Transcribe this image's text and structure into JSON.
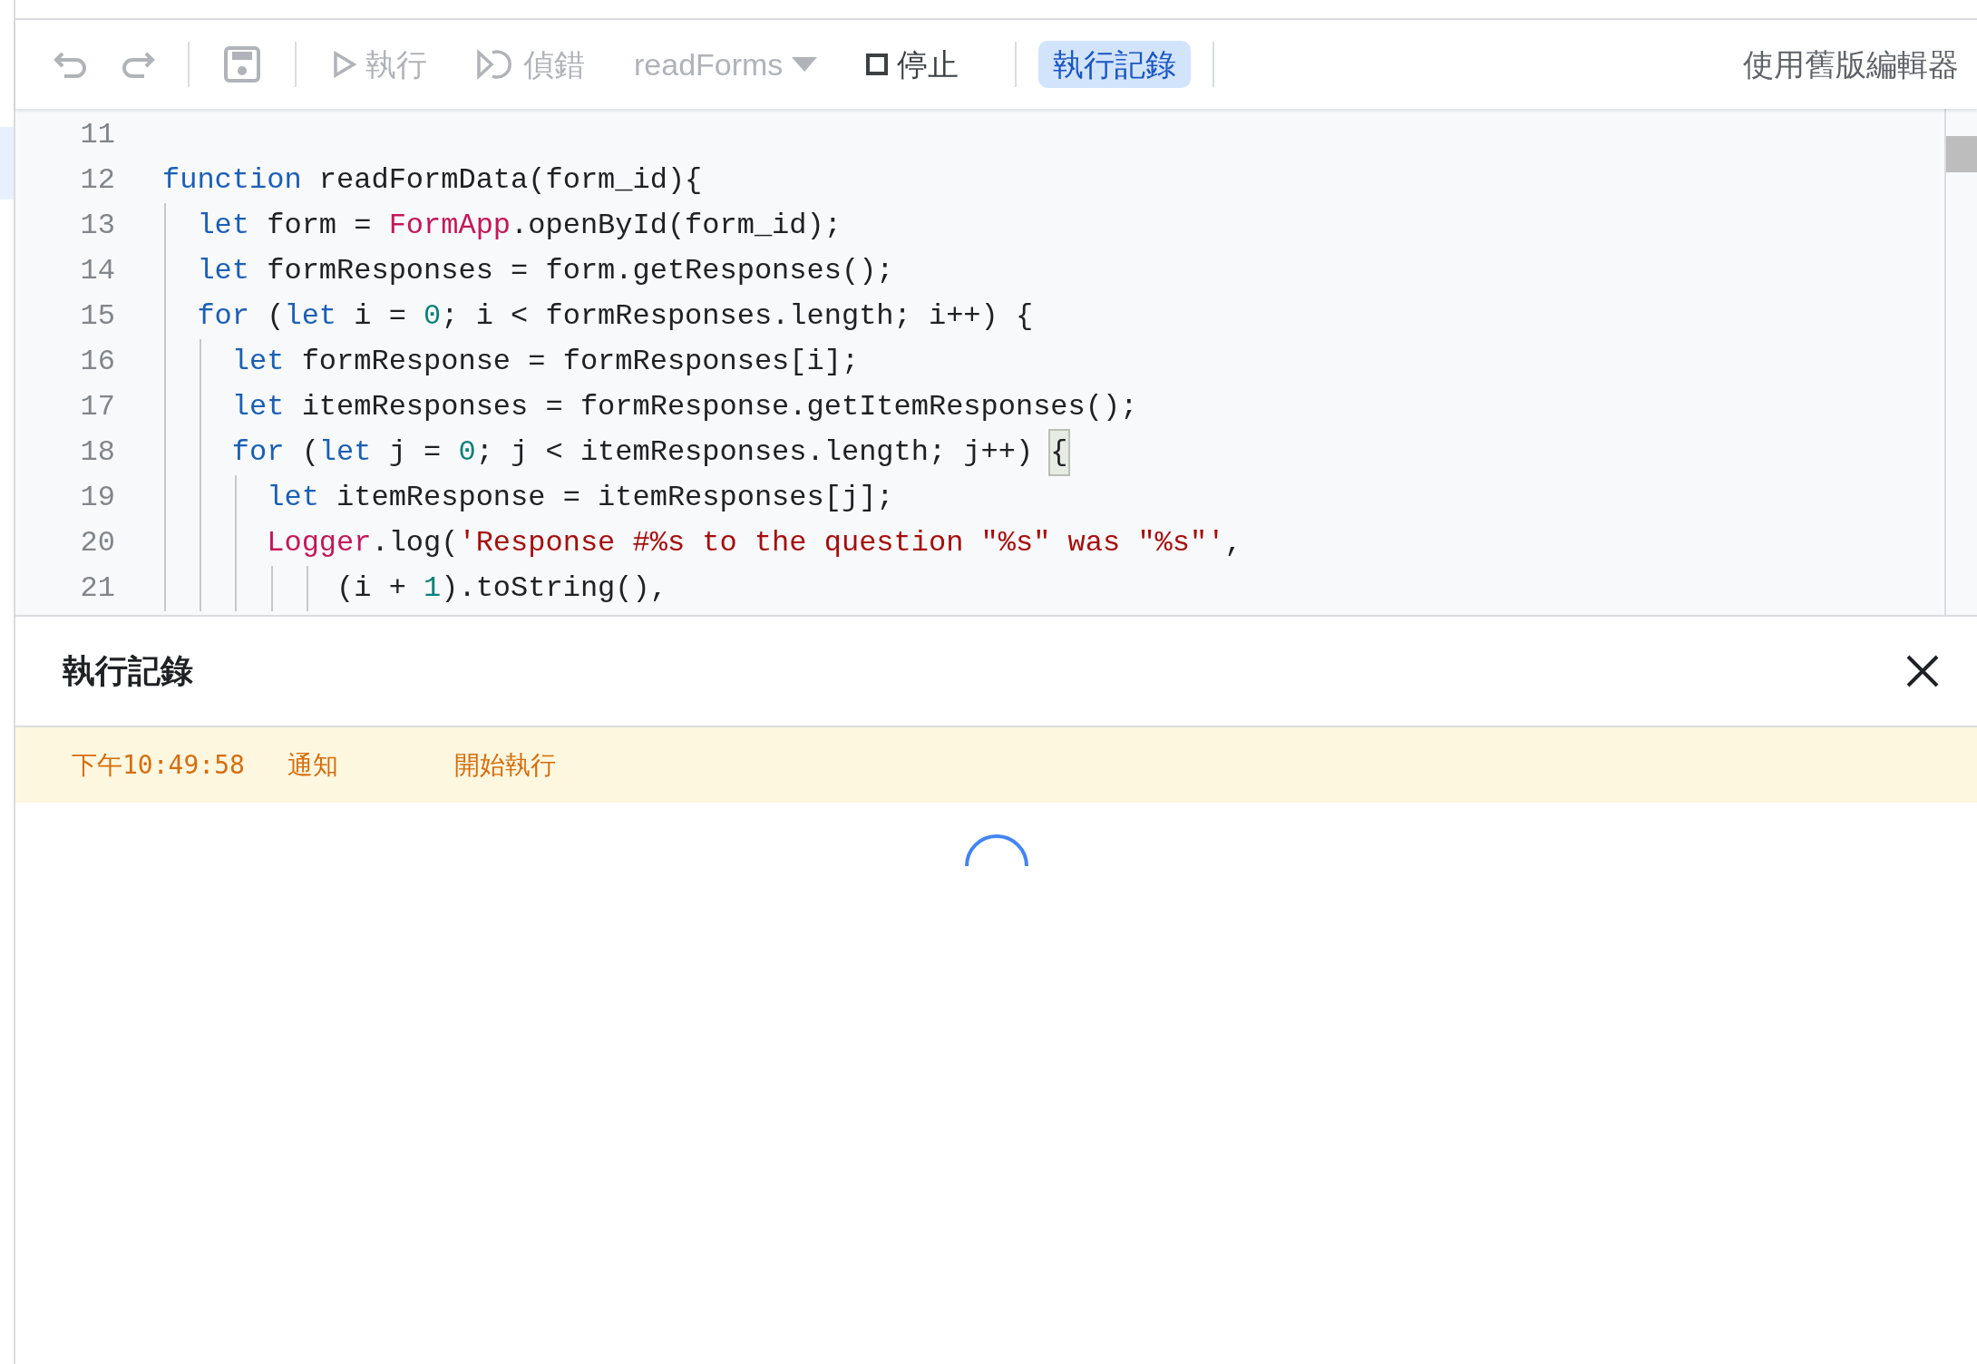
{
  "toolbar": {
    "items": [
      {
        "kind": "undo",
        "disabled": true
      },
      {
        "kind": "redo",
        "disabled": true
      },
      {
        "kind": "separator"
      },
      {
        "kind": "save",
        "disabled": true
      },
      {
        "kind": "separator"
      },
      {
        "kind": "run",
        "label": "執行",
        "disabled": true
      },
      {
        "kind": "debug",
        "label": "偵錯",
        "disabled": true
      },
      {
        "kind": "dropdown",
        "label": "readForms",
        "disabled": true
      },
      {
        "kind": "stop",
        "label": "停止",
        "disabled": false
      },
      {
        "kind": "separator"
      },
      {
        "kind": "toggle",
        "label": "執行記錄",
        "selected": true
      },
      {
        "kind": "separator"
      }
    ],
    "legacy_button": "使用舊版編輯器"
  },
  "editor": {
    "lines": [
      {
        "number": "11"
      },
      {
        "number": "12",
        "tokens": [
          {
            "kind": "keyword",
            "text": "function"
          },
          {
            "kind": "plain",
            "text": " readFormData(form_id){"
          }
        ]
      },
      {
        "number": "13",
        "tokens": [
          {
            "kind": "keyword",
            "text": "  let"
          },
          {
            "kind": "plain",
            "text": " form = "
          },
          {
            "kind": "class",
            "text": "FormApp"
          },
          {
            "kind": "plain",
            "text": ".openById(form_id);"
          }
        ]
      },
      {
        "number": "14",
        "tokens": [
          {
            "kind": "keyword",
            "text": "  let"
          },
          {
            "kind": "plain",
            "text": " formResponses = form.getResponses();"
          }
        ]
      },
      {
        "number": "15",
        "tokens": [
          {
            "kind": "keyword",
            "text": "  for"
          },
          {
            "kind": "plain",
            "text": " ("
          },
          {
            "kind": "keyword",
            "text": "let"
          },
          {
            "kind": "plain",
            "text": " i = "
          },
          {
            "kind": "number",
            "text": "0"
          },
          {
            "kind": "plain",
            "text": "; i < formResponses.length; i++) {"
          }
        ]
      },
      {
        "number": "16",
        "tokens": [
          {
            "kind": "keyword",
            "text": "    let"
          },
          {
            "kind": "plain",
            "text": " formResponse = formResponses[i];"
          }
        ]
      },
      {
        "number": "17",
        "tokens": [
          {
            "kind": "keyword",
            "text": "    let"
          },
          {
            "kind": "plain",
            "text": " itemResponses = formResponse.getItemResponses();"
          }
        ]
      },
      {
        "number": "18",
        "tokens": [
          {
            "kind": "keyword",
            "text": "    for"
          },
          {
            "kind": "plain",
            "text": " ("
          },
          {
            "kind": "keyword",
            "text": "let"
          },
          {
            "kind": "plain",
            "text": " j = "
          },
          {
            "kind": "number",
            "text": "0"
          },
          {
            "kind": "plain",
            "text": "; j < itemResponses.length; j++) "
          },
          {
            "kind": "bracket-match",
            "text": "{"
          }
        ]
      },
      {
        "number": "19",
        "tokens": [
          {
            "kind": "keyword",
            "text": "      let"
          },
          {
            "kind": "plain",
            "text": " itemResponse = itemResponses[j];"
          }
        ]
      },
      {
        "number": "20",
        "tokens": [
          {
            "kind": "class",
            "text": "      Logger"
          },
          {
            "kind": "plain",
            "text": ".log("
          },
          {
            "kind": "string",
            "text": "'Response #%s to the question \"%s\" was \"%s\"'"
          },
          {
            "kind": "plain",
            "text": ","
          }
        ]
      },
      {
        "number": "21",
        "tokens": [
          {
            "kind": "plain",
            "text": "          (i + "
          },
          {
            "kind": "number",
            "text": "1"
          },
          {
            "kind": "plain",
            "text": ").toString(),"
          }
        ]
      }
    ]
  },
  "log_panel": {
    "title": "執行記錄",
    "entries": [
      {
        "kind": "notice",
        "time": "下午10:49:58",
        "level": "通知",
        "message": "開始執行"
      }
    ],
    "loading": true
  }
}
